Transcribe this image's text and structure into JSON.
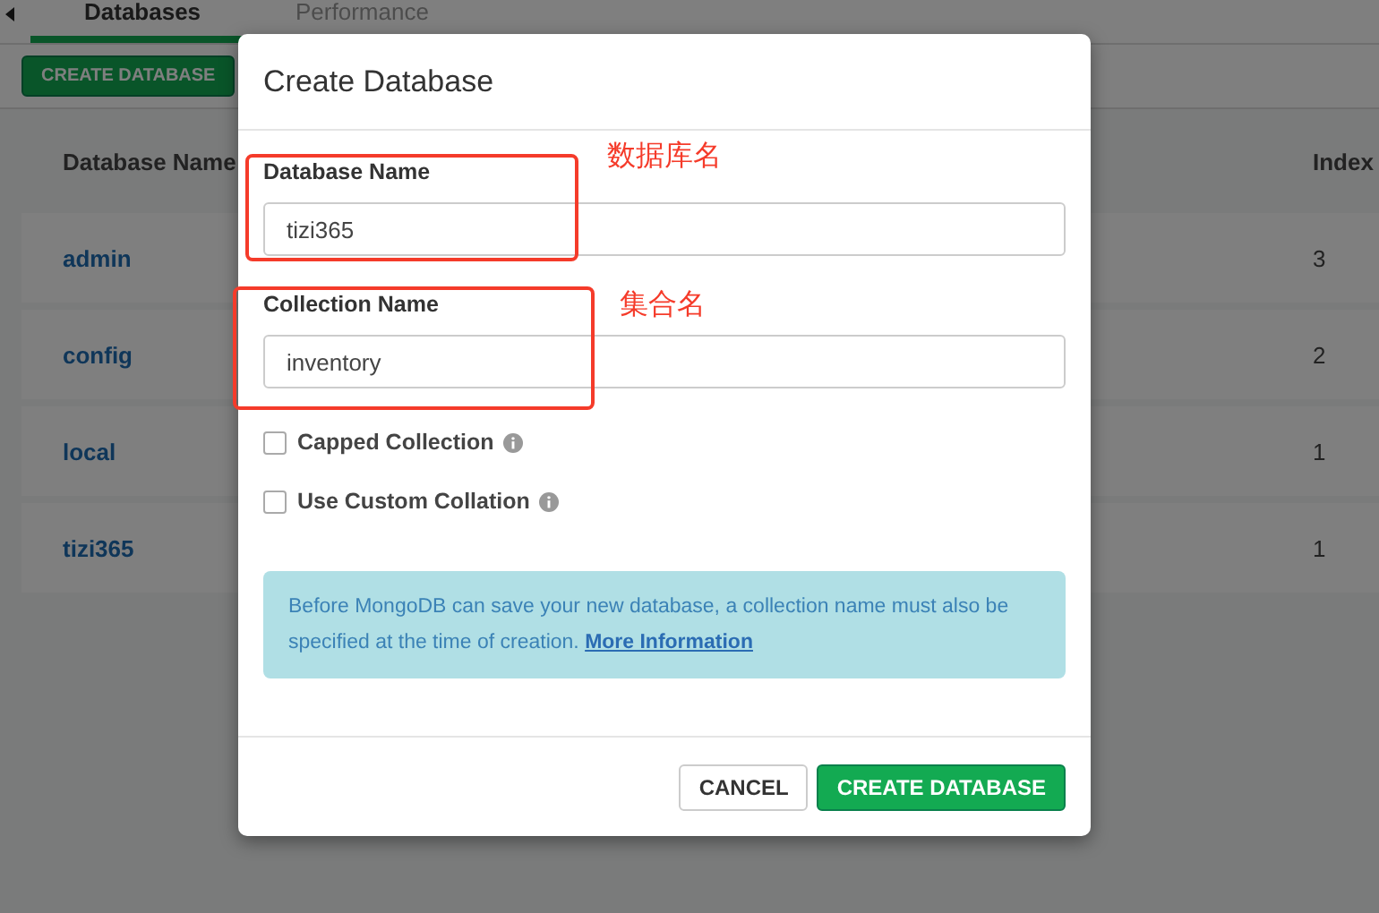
{
  "tabs": [
    {
      "label": "Databases",
      "selected": true
    },
    {
      "label": "Performance",
      "selected": false
    }
  ],
  "toolbar_button": "CREATE DATABASE",
  "table": {
    "columns": [
      "Database Name",
      "Index"
    ],
    "rows": [
      {
        "name": "admin",
        "indexes": "3"
      },
      {
        "name": "config",
        "indexes": "2"
      },
      {
        "name": "local",
        "indexes": "1"
      },
      {
        "name": "tizi365",
        "indexes": "1"
      }
    ]
  },
  "dialog": {
    "title": "Create Database",
    "fields": [
      {
        "label": "Database Name",
        "value": "tizi365"
      },
      {
        "label": "Collection Name",
        "value": "inventory"
      }
    ],
    "checkboxes": [
      {
        "label": "Capped Collection",
        "checked": false
      },
      {
        "label": "Use Custom Collation",
        "checked": false
      }
    ],
    "notice": {
      "text": "Before MongoDB can save your new database, a collection name must also be specified at the time of creation.",
      "link": "More Information"
    },
    "buttons": [
      {
        "label": "CANCEL",
        "kind": "secondary"
      },
      {
        "label": "CREATE DATABASE",
        "kind": "primary"
      }
    ]
  },
  "annotations": [
    {
      "label": "数据库名"
    },
    {
      "label": "集合名"
    }
  ]
}
